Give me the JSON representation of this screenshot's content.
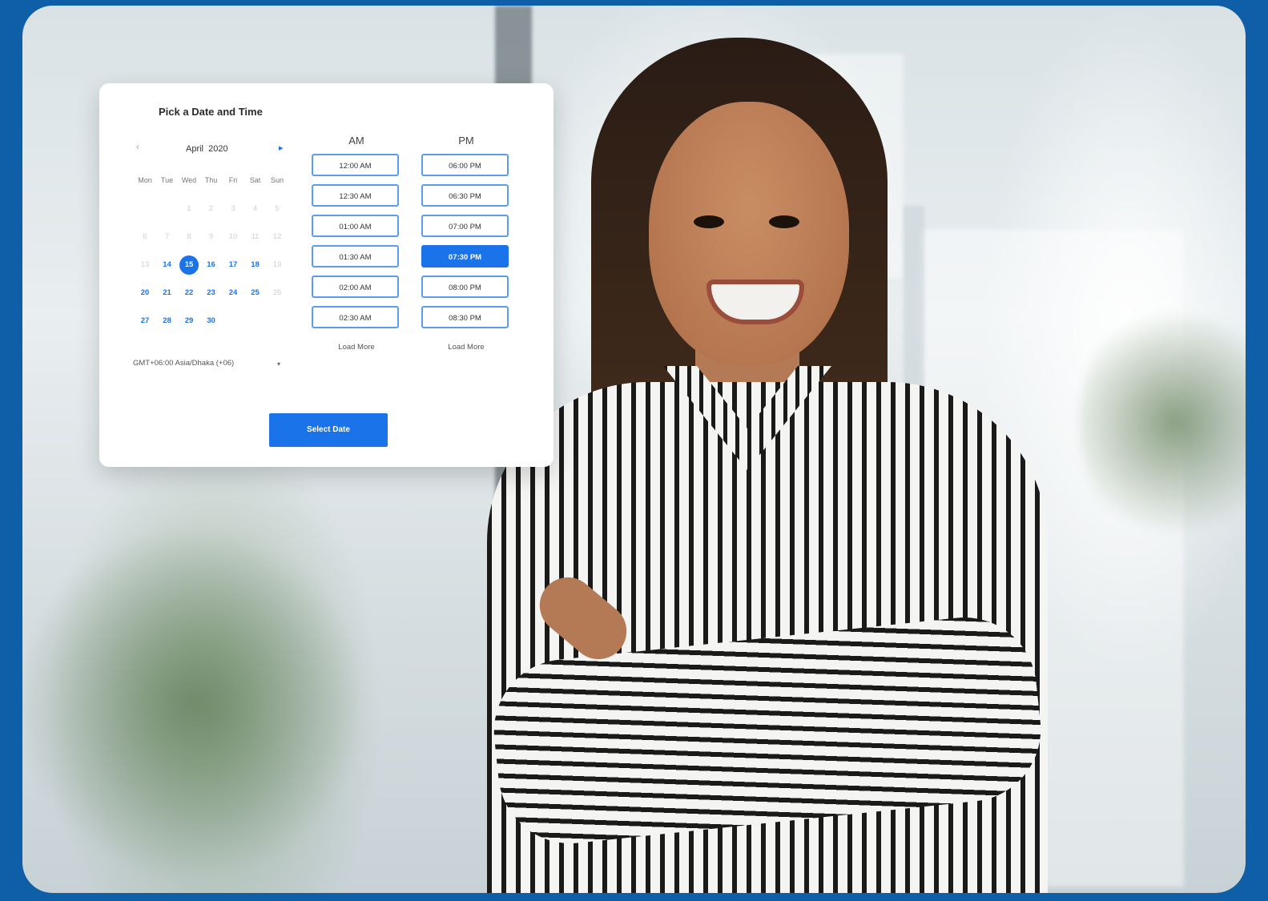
{
  "colors": {
    "frame": "#0f5ea8",
    "accent": "#1a73e8",
    "card": "#ffffff"
  },
  "scheduler": {
    "title": "Pick a Date and Time",
    "calendar": {
      "prev_icon": "chevron-left-icon",
      "next_icon": "chevron-right-icon",
      "prev_glyph": "‹",
      "next_glyph": "▸",
      "month": "April",
      "year": "2020",
      "weekdays": [
        "Mon",
        "Tue",
        "Wed",
        "Thu",
        "Fri",
        "Sat",
        "Sun"
      ],
      "weeks": [
        [
          {
            "d": ""
          },
          {
            "d": ""
          },
          {
            "d": "1",
            "s": "muted"
          },
          {
            "d": "2",
            "s": "muted"
          },
          {
            "d": "3",
            "s": "muted"
          },
          {
            "d": "4",
            "s": "muted"
          },
          {
            "d": "5",
            "s": "muted"
          }
        ],
        [
          {
            "d": "6",
            "s": "muted"
          },
          {
            "d": "7",
            "s": "muted"
          },
          {
            "d": "8",
            "s": "muted"
          },
          {
            "d": "9",
            "s": "muted"
          },
          {
            "d": "10",
            "s": "muted"
          },
          {
            "d": "11",
            "s": "muted"
          },
          {
            "d": "12",
            "s": "muted"
          }
        ],
        [
          {
            "d": "13",
            "s": "muted"
          },
          {
            "d": "14",
            "s": "active"
          },
          {
            "d": "15",
            "s": "selected"
          },
          {
            "d": "16",
            "s": "active"
          },
          {
            "d": "17",
            "s": "active"
          },
          {
            "d": "18",
            "s": "active"
          },
          {
            "d": "19",
            "s": "muted"
          }
        ],
        [
          {
            "d": "20",
            "s": "active"
          },
          {
            "d": "21",
            "s": "active"
          },
          {
            "d": "22",
            "s": "active"
          },
          {
            "d": "23",
            "s": "active"
          },
          {
            "d": "24",
            "s": "active"
          },
          {
            "d": "25",
            "s": "active"
          },
          {
            "d": "26",
            "s": "muted"
          }
        ],
        [
          {
            "d": "27",
            "s": "active"
          },
          {
            "d": "28",
            "s": "active"
          },
          {
            "d": "29",
            "s": "active"
          },
          {
            "d": "30",
            "s": "active"
          },
          {
            "d": ""
          },
          {
            "d": ""
          },
          {
            "d": ""
          }
        ]
      ],
      "selected_day": "15"
    },
    "timezone": {
      "value": "GMT+06:00 Asia/Dhaka (+06)",
      "caret": "▾"
    },
    "am": {
      "label": "AM",
      "slots": [
        "12:00 AM",
        "12:30 AM",
        "01:00 AM",
        "01:30 AM",
        "02:00 AM",
        "02:30 AM"
      ],
      "load_more": "Load More"
    },
    "pm": {
      "label": "PM",
      "slots": [
        "06:00 PM",
        "06:30 PM",
        "07:00 PM",
        "07:30 PM",
        "08:00 PM",
        "08:30 PM"
      ],
      "selected": "07:30 PM",
      "load_more": "Load More"
    },
    "select_button": "Select Date"
  }
}
